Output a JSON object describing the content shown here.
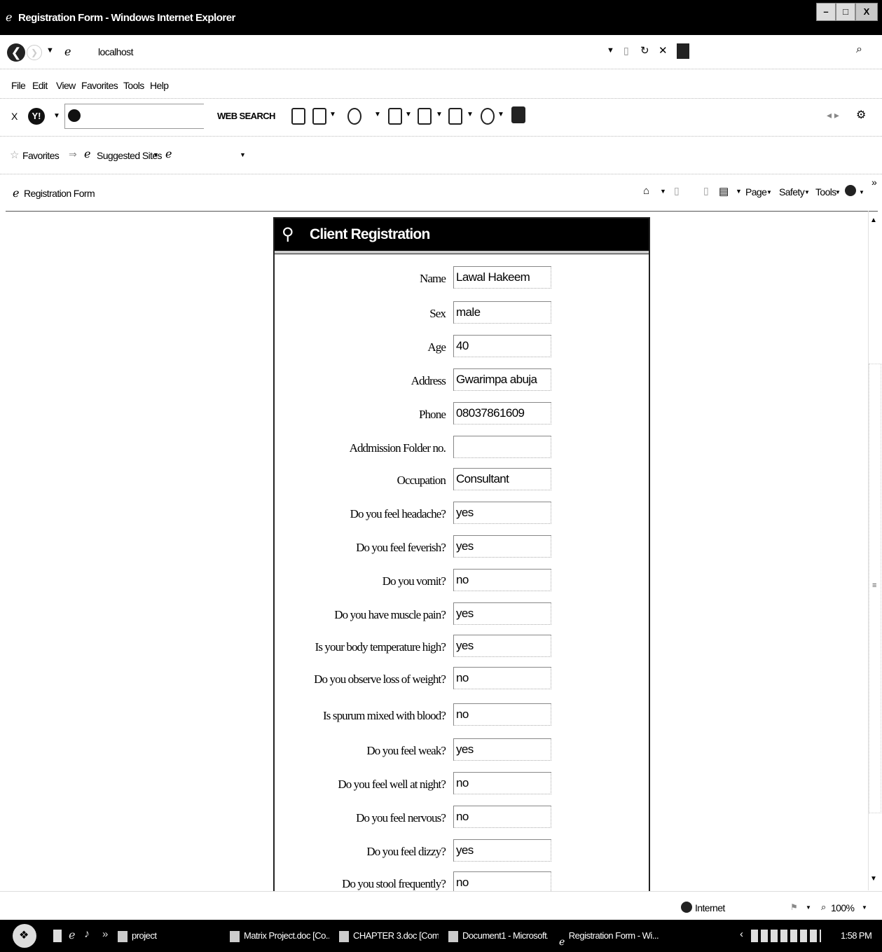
{
  "window": {
    "title": "Registration Form - Windows Internet Explorer",
    "minimize": "–",
    "maximize": "□",
    "close": "X"
  },
  "address_bar": {
    "url": "localhost"
  },
  "menu": [
    "File",
    "Edit",
    "View",
    "Favorites",
    "Tools",
    "Help"
  ],
  "yahoo_toolbar": {
    "close": "X",
    "logo": "Y!",
    "search_button": "WEB SEARCH"
  },
  "favorites_bar": {
    "favorites": "Favorites",
    "suggested_sites": "Suggested Sites"
  },
  "tab": {
    "label": "Registration Form"
  },
  "command_bar": {
    "page": "Page",
    "safety": "Safety",
    "tools": "Tools"
  },
  "form": {
    "title": "Client Registration",
    "fields": [
      {
        "label": "Name",
        "value": "Lawal Hakeem"
      },
      {
        "label": "Sex",
        "value": "male"
      },
      {
        "label": "Age",
        "value": "40"
      },
      {
        "label": "Address",
        "value": "Gwarimpa abuja"
      },
      {
        "label": "Phone",
        "value": "08037861609"
      },
      {
        "label": "Addmission Folder no.",
        "value": ""
      },
      {
        "label": "Occupation",
        "value": "Consultant"
      },
      {
        "label": "Do you feel headache?",
        "value": "yes"
      },
      {
        "label": "Do you feel feverish?",
        "value": "yes"
      },
      {
        "label": "Do you vomit?",
        "value": "no"
      },
      {
        "label": "Do you have muscle pain?",
        "value": "yes"
      },
      {
        "label": "Is your body temperature high?",
        "value": "yes"
      },
      {
        "label": "Do you observe loss of weight?",
        "value": "no"
      },
      {
        "label": "Is spurum mixed with blood?",
        "value": "no"
      },
      {
        "label": "Do you feel weak?",
        "value": "yes"
      },
      {
        "label": "Do you feel well at night?",
        "value": "no"
      },
      {
        "label": "Do you feel nervous?",
        "value": "no"
      },
      {
        "label": "Do you feel dizzy?",
        "value": "yes"
      },
      {
        "label": "Do you stool frequently?",
        "value": "no"
      }
    ]
  },
  "status_bar": {
    "zone": "Internet",
    "zoom": "100%"
  },
  "taskbar": {
    "quicklaunch_more": "»",
    "items": [
      "project",
      "Matrix Project.doc [Co...",
      "CHAPTER 3.doc [Com...",
      "Document1 - Microsoft...",
      "Registration Form - Wi..."
    ],
    "clock": "1:58 PM"
  }
}
